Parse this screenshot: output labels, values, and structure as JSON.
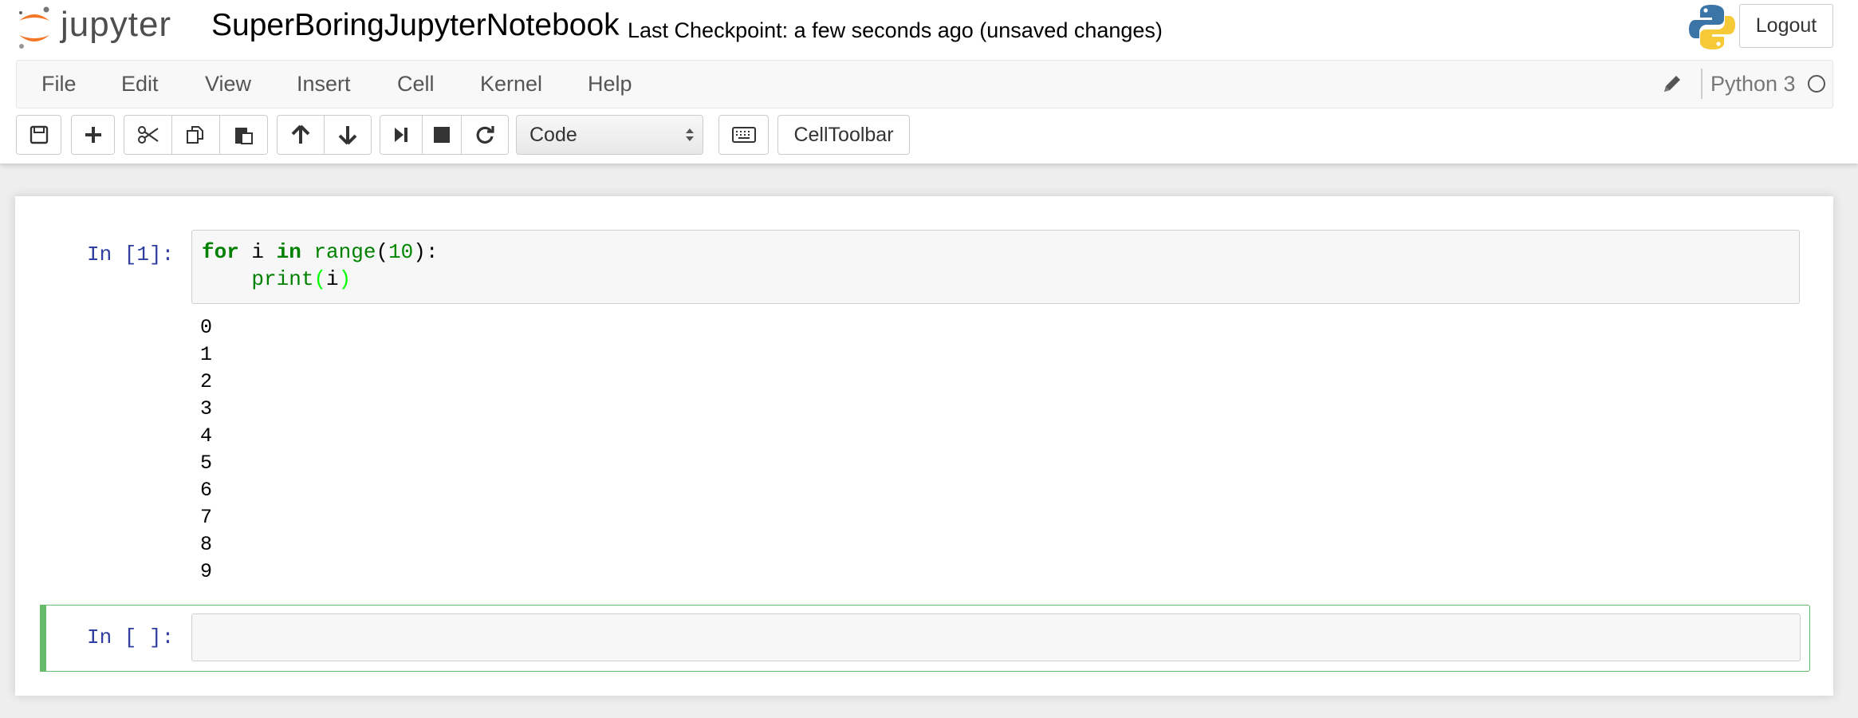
{
  "header": {
    "logo_text": "jupyter",
    "notebook_name": "SuperBoringJupyterNotebook",
    "checkpoint": "Last Checkpoint: a few seconds ago (unsaved changes)",
    "logout_label": "Logout"
  },
  "menubar": {
    "items": [
      "File",
      "Edit",
      "View",
      "Insert",
      "Cell",
      "Kernel",
      "Help"
    ],
    "kernel_name": "Python 3"
  },
  "toolbar": {
    "cell_type": "Code",
    "celltoolbar_label": "CellToolbar",
    "icons": [
      "save-icon",
      "plus-icon",
      "cut-icon",
      "copy-icon",
      "paste-icon",
      "arrow-up-icon",
      "arrow-down-icon",
      "run-next-icon",
      "stop-icon",
      "restart-icon",
      "keyboard-icon"
    ]
  },
  "cells": [
    {
      "prompt": "In [1]:",
      "code": {
        "line1": {
          "kw_for": "for",
          "var": " i ",
          "kw_in": "in",
          "space": " ",
          "fn": "range",
          "open": "(",
          "num": "10",
          "close": "):"
        },
        "line2": {
          "indent": "    ",
          "fn": "print",
          "open": "(",
          "arg": "i",
          "close": ")"
        }
      },
      "output": [
        "0",
        "1",
        "2",
        "3",
        "4",
        "5",
        "6",
        "7",
        "8",
        "9"
      ]
    },
    {
      "prompt": "In [ ]:",
      "code": ""
    }
  ],
  "colors": {
    "prompt_in": "#303f9f",
    "keyword": "#008000",
    "active_cell_border": "#66bb6a"
  }
}
